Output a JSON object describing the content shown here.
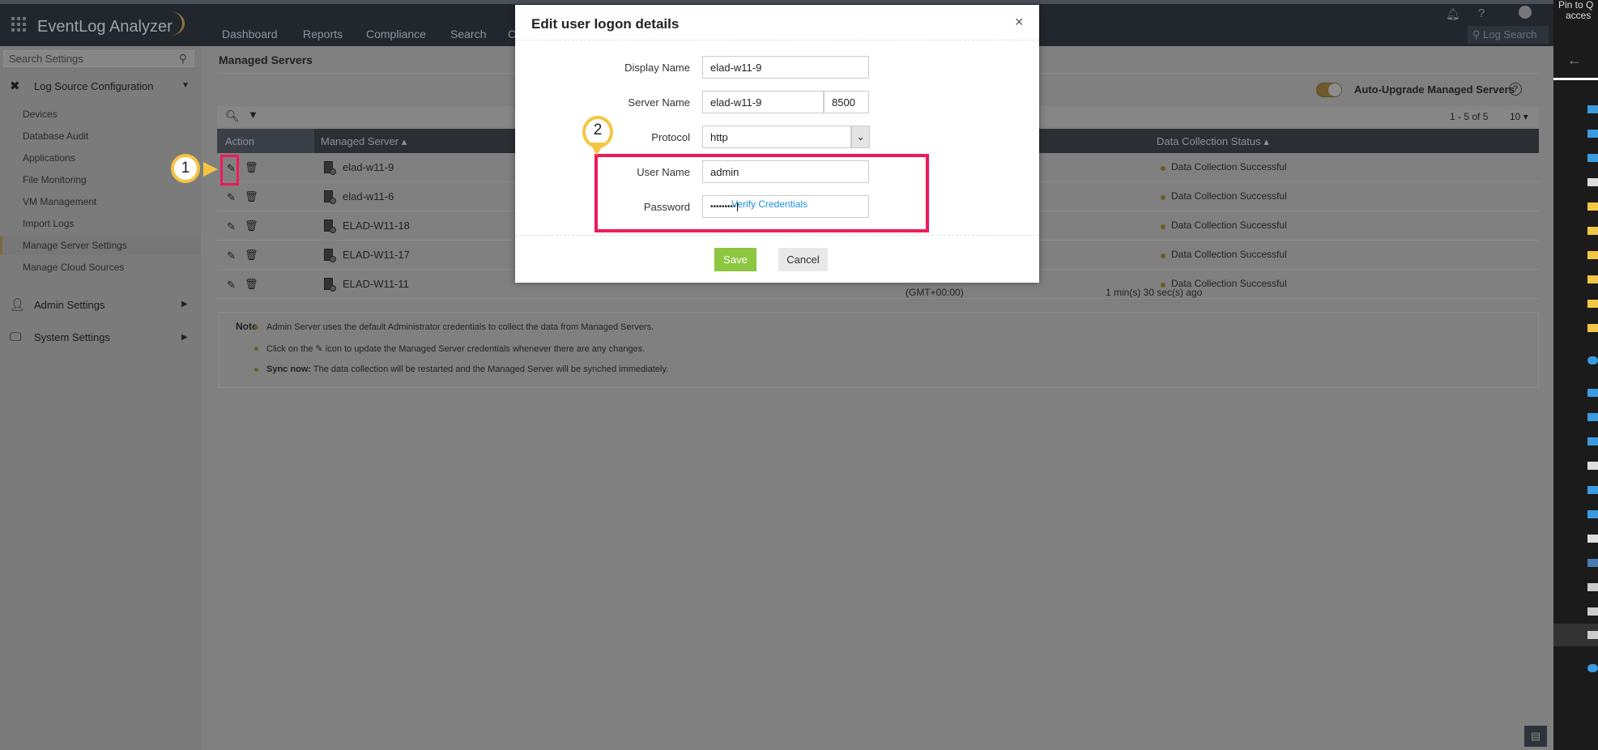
{
  "app": {
    "title": "EventLog Analyzer"
  },
  "nav": [
    "Dashboard",
    "Reports",
    "Compliance",
    "Search",
    "C"
  ],
  "header_right": {
    "log_search": "Log Search",
    "help": "?"
  },
  "win_panel": {
    "pin_text": "Pin to Q",
    "pin_text2": "acces"
  },
  "sidebar": {
    "search_placeholder": "Search Settings",
    "section_log": "Log Source Configuration",
    "items": [
      "Devices",
      "Database Audit",
      "Applications",
      "File Monitoring",
      "VM Management",
      "Import Logs",
      "Manage Server Settings",
      "Manage Cloud Sources"
    ],
    "active": "Manage Server Settings",
    "admin": "Admin Settings",
    "system": "System Settings"
  },
  "main": {
    "title": "Managed Servers",
    "auto_upgrade": "Auto-Upgrade Managed Servers",
    "auto_upgrade_on": true,
    "pager": "1 - 5 of 5",
    "per_page": "10",
    "columns": {
      "action": "Action",
      "server": "Managed Server",
      "status": "Data Collection Status"
    },
    "rows": [
      {
        "name": "elad-w11-9",
        "status": "Data Collection Successful"
      },
      {
        "name": "elad-w11-6",
        "status": "Data Collection Successful"
      },
      {
        "name": "ELAD-W11-18",
        "status": "Data Collection Successful"
      },
      {
        "name": "ELAD-W11-17",
        "status": "Data Collection Successful"
      },
      {
        "name": "ELAD-W11-11",
        "status": "Data Collection Successful",
        "tz": "(GMT+00:00)",
        "ago": "1 min(s) 30 sec(s) ago"
      }
    ],
    "note": {
      "label": "Note",
      "lines": [
        "Admin Server uses the default Administrator credentials to collect the data from Managed Servers.",
        "Click on the",
        "icon to update the Managed Server credentials whenever there are any changes.",
        "Sync now:",
        "The data collection will be restarted and the Managed Server will be synched immediately."
      ]
    }
  },
  "modal": {
    "title": "Edit user logon details",
    "close": "×",
    "display_name_label": "Display Name",
    "display_name": "elad-w11-9",
    "server_name_label": "Server Name",
    "server_name": "elad-w11-9",
    "port": "8500",
    "protocol_label": "Protocol",
    "protocol": "http",
    "user_label": "User Name",
    "user": "admin",
    "password_label": "Password",
    "password": "•••••••••",
    "verify": "Verify Credentials",
    "save": "Save",
    "cancel": "Cancel"
  },
  "annotations": [
    "1",
    "2"
  ],
  "colors": {
    "accent_pink": "#f0195a",
    "annotation_yellow": "#f4c542",
    "save_green": "#8dc63f",
    "link_blue": "#1a8fe0"
  }
}
